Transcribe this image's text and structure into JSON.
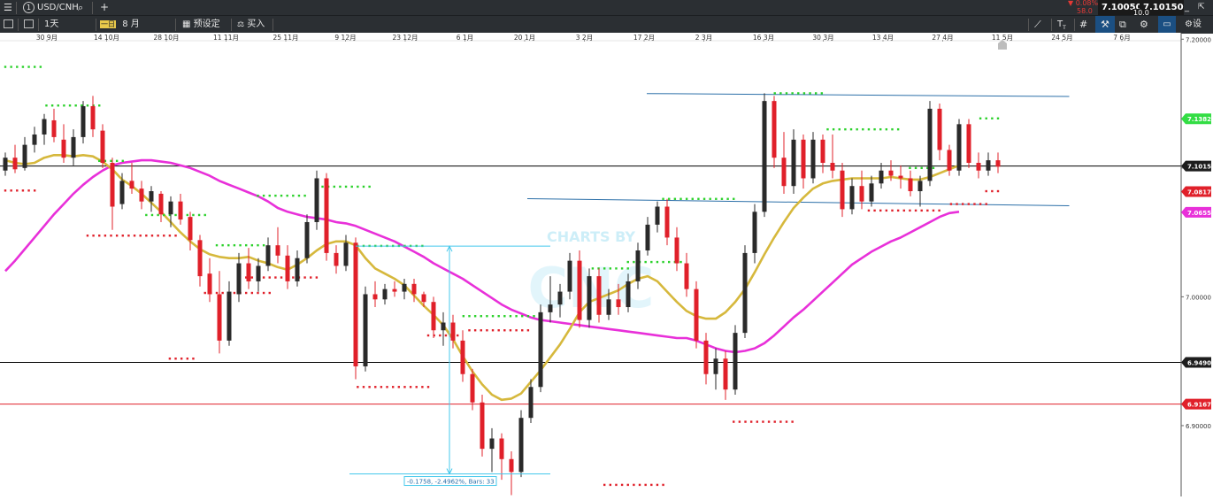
{
  "toolbar": {
    "menu_icon": "hamburger-icon",
    "symbol_number": "1",
    "symbol": "USD/CNH",
    "search_icon": "search-icon",
    "add_tab": "+",
    "timeframe": "1天",
    "period_prefix": "一日",
    "period": "8 月",
    "preset_label": "预设定",
    "buy_label": "买入",
    "settings_label": "设",
    "change_pct": "▼ 0.08%",
    "change_sub": "58.0",
    "bid": "7.10050",
    "ask": "7.10150",
    "spread": "10.0"
  },
  "colors": {
    "bull": "#2a2a2a",
    "bear": "#e0202a",
    "ma_fast": "#d6b83c",
    "ma_slow": "#e830d9",
    "dot_green": "#2bd12b",
    "dot_red": "#e0202a",
    "trendline": "#2b6fa8",
    "measure": "#44c8ec",
    "hline_black": "#000000",
    "hline_red": "#e0202a"
  },
  "chart_data": {
    "type": "candlestick",
    "title": "",
    "xlabel": "",
    "ylabel": "",
    "x_tick_labels": [
      "30 9月",
      "14 10月",
      "28 10月",
      "11 11月",
      "25 11月",
      "9 12月",
      "23 12月",
      "6 1月",
      "20 1月",
      "3 2月",
      "17 2月",
      "2 3月",
      "16 3月",
      "30 3月",
      "13 4月",
      "27 4月",
      "11 5月",
      "24 5月",
      "7 6月"
    ],
    "y_tick_labels": [
      "7.20000",
      "7.10000",
      "7.00000",
      "6.90000"
    ],
    "y_ticks": [
      7.2,
      7.1,
      7.0,
      6.9
    ],
    "ylim": [
      6.845,
      7.205
    ],
    "watermark": "CHARTS BY",
    "price_labels": [
      {
        "text": "7.13820",
        "value": 7.1382,
        "style": "green"
      },
      {
        "text": "7.10150",
        "value": 7.1015,
        "style": "dark"
      },
      {
        "text": "7.08172",
        "value": 7.0817,
        "style": "red"
      },
      {
        "text": "7.06556",
        "value": 7.0656,
        "style": "magenta"
      },
      {
        "text": "6.94909",
        "value": 6.9491,
        "style": "dark"
      },
      {
        "text": "6.91671",
        "value": 6.9167,
        "style": "red"
      }
    ],
    "horizontal_lines": [
      {
        "value": 7.1015,
        "color": "black"
      },
      {
        "value": 6.9491,
        "color": "black"
      },
      {
        "value": 6.9167,
        "color": "red"
      }
    ],
    "trendlines": [
      {
        "from": [
          "16 3月",
          7.1578
        ],
        "to": [
          "24 5月",
          7.1555
        ]
      },
      {
        "from": [
          "17 2月",
          7.0762
        ],
        "to": [
          "24 5月",
          7.0707
        ]
      }
    ],
    "measure": {
      "label": "-0.1758, -2.4962%, Bars:  33",
      "high": 7.0393,
      "low": 6.8625
    },
    "candles": [
      {
        "o": 7.098,
        "h": 7.112,
        "l": 7.094,
        "c": 7.108
      },
      {
        "o": 7.108,
        "h": 7.118,
        "l": 7.096,
        "c": 7.099
      },
      {
        "o": 7.1,
        "h": 7.124,
        "l": 7.098,
        "c": 7.118
      },
      {
        "o": 7.118,
        "h": 7.132,
        "l": 7.112,
        "c": 7.126
      },
      {
        "o": 7.126,
        "h": 7.142,
        "l": 7.118,
        "c": 7.138
      },
      {
        "o": 7.137,
        "h": 7.146,
        "l": 7.12,
        "c": 7.124
      },
      {
        "o": 7.122,
        "h": 7.134,
        "l": 7.104,
        "c": 7.108
      },
      {
        "o": 7.108,
        "h": 7.13,
        "l": 7.102,
        "c": 7.124
      },
      {
        "o": 7.124,
        "h": 7.152,
        "l": 7.119,
        "c": 7.148
      },
      {
        "o": 7.148,
        "h": 7.156,
        "l": 7.124,
        "c": 7.13
      },
      {
        "o": 7.129,
        "h": 7.134,
        "l": 7.1,
        "c": 7.104
      },
      {
        "o": 7.104,
        "h": 7.108,
        "l": 7.052,
        "c": 7.07
      },
      {
        "o": 7.072,
        "h": 7.096,
        "l": 7.068,
        "c": 7.09
      },
      {
        "o": 7.09,
        "h": 7.104,
        "l": 7.08,
        "c": 7.084
      },
      {
        "o": 7.084,
        "h": 7.09,
        "l": 7.068,
        "c": 7.074
      },
      {
        "o": 7.074,
        "h": 7.086,
        "l": 7.066,
        "c": 7.082
      },
      {
        "o": 7.08,
        "h": 7.082,
        "l": 7.058,
        "c": 7.064
      },
      {
        "o": 7.064,
        "h": 7.078,
        "l": 7.054,
        "c": 7.074
      },
      {
        "o": 7.074,
        "h": 7.08,
        "l": 7.056,
        "c": 7.06
      },
      {
        "o": 7.062,
        "h": 7.066,
        "l": 7.036,
        "c": 7.044
      },
      {
        "o": 7.044,
        "h": 7.048,
        "l": 7.008,
        "c": 7.016
      },
      {
        "o": 7.018,
        "h": 7.03,
        "l": 6.996,
        "c": 7.002
      },
      {
        "o": 7.002,
        "h": 7.02,
        "l": 6.956,
        "c": 6.966
      },
      {
        "o": 6.966,
        "h": 7.012,
        "l": 6.962,
        "c": 7.004
      },
      {
        "o": 7.002,
        "h": 7.034,
        "l": 6.996,
        "c": 7.026
      },
      {
        "o": 7.026,
        "h": 7.038,
        "l": 7.006,
        "c": 7.012
      },
      {
        "o": 7.012,
        "h": 7.03,
        "l": 7.004,
        "c": 7.024
      },
      {
        "o": 7.024,
        "h": 7.046,
        "l": 7.02,
        "c": 7.04
      },
      {
        "o": 7.04,
        "h": 7.054,
        "l": 7.026,
        "c": 7.032
      },
      {
        "o": 7.032,
        "h": 7.04,
        "l": 7.006,
        "c": 7.012
      },
      {
        "o": 7.012,
        "h": 7.036,
        "l": 7.008,
        "c": 7.03
      },
      {
        "o": 7.03,
        "h": 7.064,
        "l": 7.026,
        "c": 7.058
      },
      {
        "o": 7.058,
        "h": 7.098,
        "l": 7.052,
        "c": 7.092
      },
      {
        "o": 7.092,
        "h": 7.096,
        "l": 7.028,
        "c": 7.034
      },
      {
        "o": 7.034,
        "h": 7.04,
        "l": 7.018,
        "c": 7.024
      },
      {
        "o": 7.024,
        "h": 7.048,
        "l": 7.02,
        "c": 7.042
      },
      {
        "o": 7.042,
        "h": 7.046,
        "l": 6.936,
        "c": 6.946
      },
      {
        "o": 6.946,
        "h": 7.008,
        "l": 6.942,
        "c": 7.002
      },
      {
        "o": 7.002,
        "h": 7.012,
        "l": 6.992,
        "c": 6.998
      },
      {
        "o": 6.998,
        "h": 7.01,
        "l": 6.994,
        "c": 7.006
      },
      {
        "o": 7.006,
        "h": 7.012,
        "l": 7.0,
        "c": 7.004
      },
      {
        "o": 7.004,
        "h": 7.014,
        "l": 6.998,
        "c": 7.01
      },
      {
        "o": 7.01,
        "h": 7.014,
        "l": 6.996,
        "c": 7.002
      },
      {
        "o": 7.002,
        "h": 7.004,
        "l": 6.992,
        "c": 6.996
      },
      {
        "o": 6.996,
        "h": 7.0,
        "l": 6.968,
        "c": 6.974
      },
      {
        "o": 6.974,
        "h": 6.988,
        "l": 6.962,
        "c": 6.98
      },
      {
        "o": 6.98,
        "h": 6.986,
        "l": 6.96,
        "c": 6.966
      },
      {
        "o": 6.966,
        "h": 6.974,
        "l": 6.934,
        "c": 6.94
      },
      {
        "o": 6.94,
        "h": 6.944,
        "l": 6.912,
        "c": 6.918
      },
      {
        "o": 6.918,
        "h": 6.924,
        "l": 6.876,
        "c": 6.882
      },
      {
        "o": 6.882,
        "h": 6.898,
        "l": 6.864,
        "c": 6.89
      },
      {
        "o": 6.89,
        "h": 6.894,
        "l": 6.858,
        "c": 6.874
      },
      {
        "o": 6.874,
        "h": 6.88,
        "l": 6.846,
        "c": 6.864
      },
      {
        "o": 6.864,
        "h": 6.912,
        "l": 6.86,
        "c": 6.906
      },
      {
        "o": 6.906,
        "h": 6.936,
        "l": 6.902,
        "c": 6.93
      },
      {
        "o": 6.93,
        "h": 6.994,
        "l": 6.926,
        "c": 6.988
      },
      {
        "o": 6.988,
        "h": 7.016,
        "l": 6.98,
        "c": 6.994
      },
      {
        "o": 6.994,
        "h": 7.01,
        "l": 6.984,
        "c": 7.004
      },
      {
        "o": 7.004,
        "h": 7.034,
        "l": 6.998,
        "c": 7.028
      },
      {
        "o": 7.028,
        "h": 7.036,
        "l": 6.976,
        "c": 6.982
      },
      {
        "o": 6.982,
        "h": 7.022,
        "l": 6.976,
        "c": 7.016
      },
      {
        "o": 7.016,
        "h": 7.022,
        "l": 6.98,
        "c": 6.986
      },
      {
        "o": 6.986,
        "h": 7.006,
        "l": 6.982,
        "c": 6.998
      },
      {
        "o": 6.998,
        "h": 7.01,
        "l": 6.986,
        "c": 6.992
      },
      {
        "o": 6.992,
        "h": 7.018,
        "l": 6.988,
        "c": 7.012
      },
      {
        "o": 7.012,
        "h": 7.042,
        "l": 7.006,
        "c": 7.036
      },
      {
        "o": 7.036,
        "h": 7.062,
        "l": 7.032,
        "c": 7.056
      },
      {
        "o": 7.056,
        "h": 7.074,
        "l": 7.05,
        "c": 7.07
      },
      {
        "o": 7.07,
        "h": 7.076,
        "l": 7.04,
        "c": 7.046
      },
      {
        "o": 7.046,
        "h": 7.054,
        "l": 7.02,
        "c": 7.026
      },
      {
        "o": 7.026,
        "h": 7.034,
        "l": 7.0,
        "c": 7.006
      },
      {
        "o": 7.006,
        "h": 7.012,
        "l": 6.96,
        "c": 6.966
      },
      {
        "o": 6.966,
        "h": 6.972,
        "l": 6.932,
        "c": 6.94
      },
      {
        "o": 6.94,
        "h": 6.96,
        "l": 6.928,
        "c": 6.952
      },
      {
        "o": 6.952,
        "h": 6.958,
        "l": 6.92,
        "c": 6.928
      },
      {
        "o": 6.928,
        "h": 6.978,
        "l": 6.924,
        "c": 6.972
      },
      {
        "o": 6.972,
        "h": 7.04,
        "l": 6.968,
        "c": 7.034
      },
      {
        "o": 7.034,
        "h": 7.072,
        "l": 7.026,
        "c": 7.066
      },
      {
        "o": 7.066,
        "h": 7.158,
        "l": 7.062,
        "c": 7.152
      },
      {
        "o": 7.152,
        "h": 7.156,
        "l": 7.1,
        "c": 7.108
      },
      {
        "o": 7.108,
        "h": 7.128,
        "l": 7.08,
        "c": 7.086
      },
      {
        "o": 7.086,
        "h": 7.13,
        "l": 7.08,
        "c": 7.122
      },
      {
        "o": 7.122,
        "h": 7.126,
        "l": 7.084,
        "c": 7.092
      },
      {
        "o": 7.092,
        "h": 7.128,
        "l": 7.088,
        "c": 7.122
      },
      {
        "o": 7.122,
        "h": 7.126,
        "l": 7.096,
        "c": 7.104
      },
      {
        "o": 7.104,
        "h": 7.126,
        "l": 7.092,
        "c": 7.098
      },
      {
        "o": 7.098,
        "h": 7.104,
        "l": 7.062,
        "c": 7.068
      },
      {
        "o": 7.068,
        "h": 7.092,
        "l": 7.064,
        "c": 7.086
      },
      {
        "o": 7.086,
        "h": 7.098,
        "l": 7.068,
        "c": 7.074
      },
      {
        "o": 7.074,
        "h": 7.094,
        "l": 7.07,
        "c": 7.088
      },
      {
        "o": 7.088,
        "h": 7.104,
        "l": 7.084,
        "c": 7.098
      },
      {
        "o": 7.098,
        "h": 7.106,
        "l": 7.09,
        "c": 7.094
      },
      {
        "o": 7.094,
        "h": 7.102,
        "l": 7.084,
        "c": 7.092
      },
      {
        "o": 7.092,
        "h": 7.098,
        "l": 7.078,
        "c": 7.082
      },
      {
        "o": 7.082,
        "h": 7.094,
        "l": 7.07,
        "c": 7.09
      },
      {
        "o": 7.09,
        "h": 7.152,
        "l": 7.086,
        "c": 7.146
      },
      {
        "o": 7.146,
        "h": 7.15,
        "l": 7.106,
        "c": 7.114
      },
      {
        "o": 7.114,
        "h": 7.118,
        "l": 7.094,
        "c": 7.098
      },
      {
        "o": 7.098,
        "h": 7.138,
        "l": 7.094,
        "c": 7.134
      },
      {
        "o": 7.134,
        "h": 7.138,
        "l": 7.1,
        "c": 7.104
      },
      {
        "o": 7.104,
        "h": 7.112,
        "l": 7.092,
        "c": 7.098
      },
      {
        "o": 7.098,
        "h": 7.112,
        "l": 7.094,
        "c": 7.106
      },
      {
        "o": 7.106,
        "h": 7.112,
        "l": 7.096,
        "c": 7.101
      }
    ],
    "ma_fast": [
      7.106,
      7.104,
      7.103,
      7.104,
      7.108,
      7.11,
      7.11,
      7.109,
      7.11,
      7.109,
      7.105,
      7.099,
      7.091,
      7.086,
      7.08,
      7.073,
      7.066,
      7.058,
      7.05,
      7.043,
      7.037,
      7.033,
      7.031,
      7.03,
      7.03,
      7.031,
      7.028,
      7.026,
      7.023,
      7.021,
      7.025,
      7.03,
      7.036,
      7.041,
      7.043,
      7.043,
      7.04,
      7.03,
      7.022,
      7.018,
      7.014,
      7.009,
      7.001,
      6.993,
      6.986,
      6.978,
      6.967,
      6.954,
      6.942,
      6.932,
      6.924,
      6.92,
      6.921,
      6.925,
      6.934,
      6.943,
      6.953,
      6.963,
      6.975,
      6.988,
      6.996,
      6.999,
      7.002,
      7.005,
      7.01,
      7.014,
      7.016,
      7.012,
      7.004,
      6.996,
      6.989,
      6.985,
      6.983,
      6.983,
      6.988,
      6.996,
      7.006,
      7.019,
      7.033,
      7.046,
      7.058,
      7.069,
      7.077,
      7.084,
      7.088,
      7.09,
      7.091,
      7.092,
      7.092,
      7.092,
      7.092,
      7.093,
      7.092,
      7.091,
      7.091,
      7.093,
      7.096,
      7.099,
      7.102
    ],
    "ma_slow": [
      7.02,
      7.028,
      7.037,
      7.046,
      7.055,
      7.064,
      7.072,
      7.08,
      7.087,
      7.093,
      7.098,
      7.102,
      7.104,
      7.105,
      7.106,
      7.106,
      7.105,
      7.104,
      7.102,
      7.1,
      7.097,
      7.094,
      7.09,
      7.087,
      7.084,
      7.081,
      7.078,
      7.074,
      7.069,
      7.066,
      7.064,
      7.062,
      7.061,
      7.06,
      7.058,
      7.057,
      7.055,
      7.052,
      7.049,
      7.046,
      7.043,
      7.039,
      7.035,
      7.031,
      7.026,
      7.022,
      7.018,
      7.014,
      7.009,
      7.004,
      6.999,
      6.994,
      6.99,
      6.987,
      6.984,
      6.982,
      6.981,
      6.98,
      6.979,
      6.978,
      6.977,
      6.976,
      6.975,
      6.974,
      6.973,
      6.972,
      6.971,
      6.97,
      6.969,
      6.968,
      6.968,
      6.966,
      6.963,
      6.96,
      6.958,
      6.957,
      6.958,
      6.96,
      6.964,
      6.97,
      6.977,
      6.984,
      6.99,
      6.997,
      7.004,
      7.011,
      7.018,
      7.025,
      7.03,
      7.035,
      7.039,
      7.043,
      7.046,
      7.05,
      7.054,
      7.058,
      7.062,
      7.065,
      7.066
    ],
    "support_resistance_dots": [
      {
        "color": "green",
        "value": 7.1785,
        "from_bar": 0,
        "to_bar": 6
      },
      {
        "color": "green",
        "value": 7.1485,
        "from_bar": 7,
        "to_bar": 16
      },
      {
        "color": "green",
        "value": 7.1055,
        "from_bar": 16,
        "to_bar": 20
      },
      {
        "color": "red",
        "value": 7.0825,
        "from_bar": 0,
        "to_bar": 5
      },
      {
        "color": "green",
        "value": 7.0635,
        "from_bar": 24,
        "to_bar": 34
      },
      {
        "color": "red",
        "value": 7.0475,
        "from_bar": 14,
        "to_bar": 29
      },
      {
        "color": "green",
        "value": 7.0785,
        "from_bar": 43,
        "to_bar": 51
      },
      {
        "color": "green",
        "value": 7.0855,
        "from_bar": 54,
        "to_bar": 62
      },
      {
        "color": "red",
        "value": 7.003,
        "from_bar": 34,
        "to_bar": 45
      },
      {
        "color": "red",
        "value": 7.015,
        "from_bar": 41,
        "to_bar": 53
      },
      {
        "color": "green",
        "value": 7.04,
        "from_bar": 36,
        "to_bar": 44
      },
      {
        "color": "red",
        "value": 6.952,
        "from_bar": 28,
        "to_bar": 32
      },
      {
        "color": "green",
        "value": 7.0395,
        "from_bar": 60,
        "to_bar": 71
      },
      {
        "color": "red",
        "value": 6.93,
        "from_bar": 60,
        "to_bar": 72
      },
      {
        "color": "red",
        "value": 6.97,
        "from_bar": 72,
        "to_bar": 77
      },
      {
        "color": "green",
        "value": 6.985,
        "from_bar": 78,
        "to_bar": 90
      },
      {
        "color": "green",
        "value": 7.022,
        "from_bar": 100,
        "to_bar": 106
      },
      {
        "color": "green",
        "value": 7.027,
        "from_bar": 106,
        "to_bar": 115
      },
      {
        "color": "red",
        "value": 6.974,
        "from_bar": 79,
        "to_bar": 89
      },
      {
        "color": "red",
        "value": 6.854,
        "from_bar": 102,
        "to_bar": 112
      },
      {
        "color": "green",
        "value": 7.076,
        "from_bar": 112,
        "to_bar": 124
      },
      {
        "color": "red",
        "value": 6.903,
        "from_bar": 124,
        "to_bar": 134
      },
      {
        "color": "green",
        "value": 7.158,
        "from_bar": 131,
        "to_bar": 139
      },
      {
        "color": "green",
        "value": 7.13,
        "from_bar": 140,
        "to_bar": 152
      },
      {
        "color": "green",
        "value": 7.1,
        "from_bar": 154,
        "to_bar": 158
      },
      {
        "color": "red",
        "value": 7.067,
        "from_bar": 147,
        "to_bar": 159
      },
      {
        "color": "green",
        "value": 7.1385,
        "from_bar": 166,
        "to_bar": 169
      },
      {
        "color": "red",
        "value": 7.072,
        "from_bar": 161,
        "to_bar": 167
      },
      {
        "color": "red",
        "value": 7.082,
        "from_bar": 167,
        "to_bar": 169
      }
    ]
  }
}
